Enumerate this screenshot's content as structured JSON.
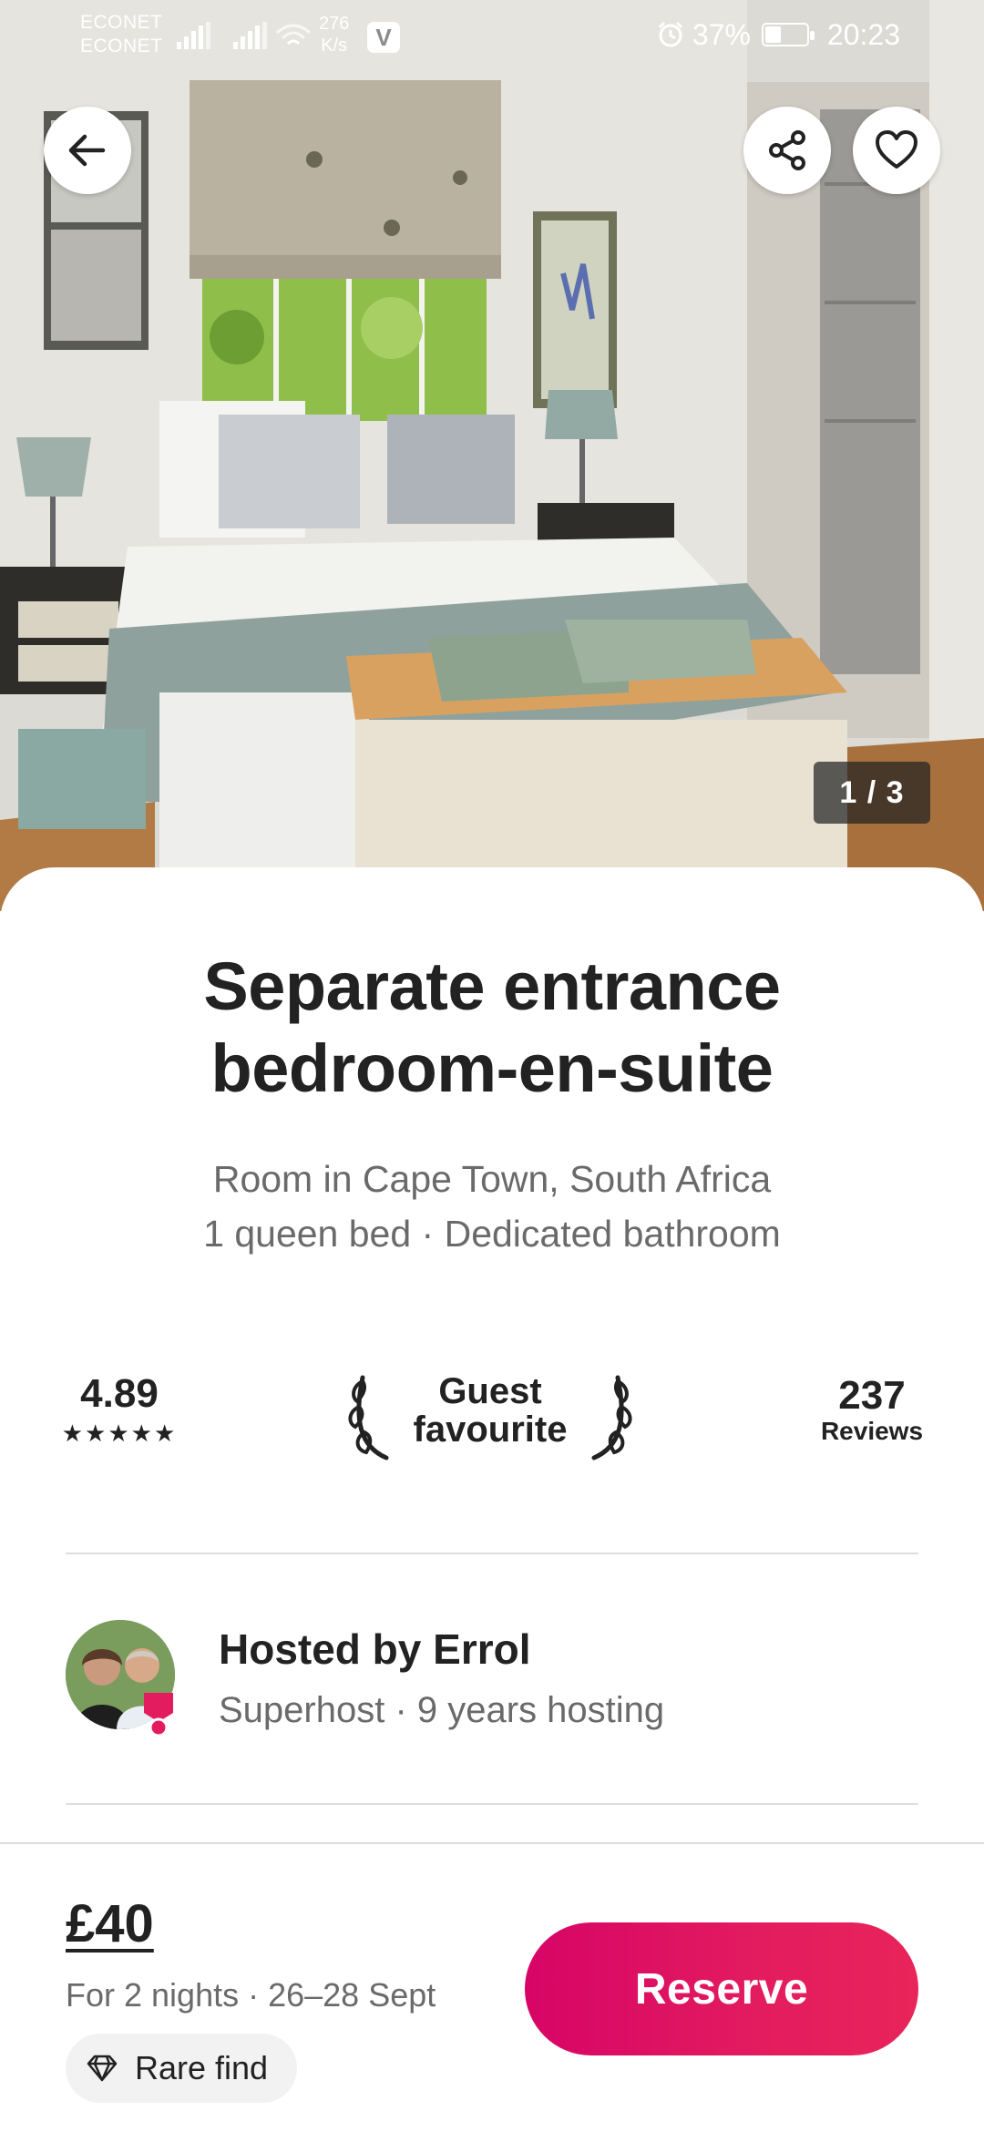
{
  "status_bar": {
    "carrier_1": "ECONET",
    "carrier_2": "ECONET",
    "net_speed_value": "276",
    "net_speed_unit": "K/s",
    "vpn_label": "V",
    "battery": "37%",
    "time": "20:23"
  },
  "photo": {
    "counter": "1 / 3"
  },
  "listing": {
    "title": "Separate entrance bedroom-en-suite",
    "location": "Room in Cape Town, South Africa",
    "details": "1 queen bed  ·  Dedicated bathroom"
  },
  "stats": {
    "rating": "4.89",
    "stars": "★★★★★",
    "guest_favourite": "Guest favourite",
    "reviews_count": "237",
    "reviews_label": "Reviews"
  },
  "host": {
    "name": "Hosted by Errol",
    "meta": "Superhost · 9 years hosting"
  },
  "footer": {
    "price": "£40",
    "price_meta": "For 2 nights · 26–28 Sept",
    "rare_find": "Rare find",
    "reserve_label": "Reserve"
  },
  "colors": {
    "brand": "#e31c5f",
    "text": "#222222",
    "muted": "#6a6a6a"
  },
  "icons": {
    "back": "arrow-left-icon",
    "share": "share-icon",
    "favourite": "heart-icon",
    "rare_find": "diamond-icon",
    "laurel": "laurel-icon",
    "superhost": "superhost-badge-icon"
  }
}
